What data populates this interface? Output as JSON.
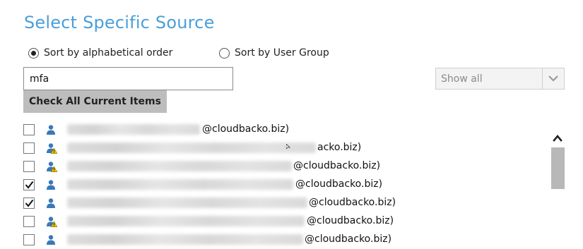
{
  "title": "Select Specific Source",
  "sort": {
    "option_alpha": "Sort by alphabetical order",
    "option_group": "Sort by User Group",
    "selected": "alpha"
  },
  "search": {
    "value": "mfa"
  },
  "check_all_label": "Check All Current Items",
  "filter": {
    "selected": "Show all"
  },
  "items": [
    {
      "checked": false,
      "warning": false,
      "email_suffix": "@cloudbacko.biz)"
    },
    {
      "checked": false,
      "warning": true,
      "email_suffix": "acko.biz)"
    },
    {
      "checked": false,
      "warning": true,
      "email_suffix": "@cloudbacko.biz)"
    },
    {
      "checked": true,
      "warning": false,
      "email_suffix": "@cloudbacko.biz)"
    },
    {
      "checked": true,
      "warning": false,
      "email_suffix": "@cloudbacko.biz)"
    },
    {
      "checked": false,
      "warning": true,
      "email_suffix": "@cloudbacko.biz)"
    },
    {
      "checked": false,
      "warning": false,
      "email_suffix": "@cloudbacko.biz)"
    }
  ],
  "colors": {
    "title": "#4a9fd9",
    "user_icon": "#3a78b8",
    "warning": "#f2c200",
    "button_bg": "#bdbdbd",
    "scroll_thumb": "#b8b8b8"
  },
  "icons": [
    "radio-button",
    "checkbox",
    "user-icon",
    "warning-icon",
    "chevron-down-icon",
    "scroll-up-icon"
  ]
}
